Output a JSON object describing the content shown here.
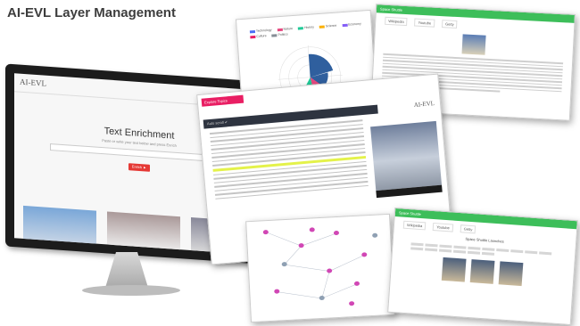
{
  "page": {
    "title": "AI-EVL Layer Management"
  },
  "monitor": {
    "logo": "AI-EVL",
    "heading": "Text Enrichment",
    "subheading": "Paste or write your text below and press Enrich",
    "button": "Enrich ►"
  },
  "topics_panel": {
    "tab": "Explore Topics",
    "bar_label": "Auto scroll  ✔",
    "logo": "AI-EVL"
  },
  "rose_panel": {
    "legend": [
      {
        "label": "Technology",
        "color": "#4c6ef5"
      },
      {
        "label": "Nature",
        "color": "#e64980"
      },
      {
        "label": "History",
        "color": "#20c997"
      },
      {
        "label": "Science",
        "color": "#fab005"
      },
      {
        "label": "Economy",
        "color": "#845ef7"
      },
      {
        "label": "Culture",
        "color": "#e91e63"
      },
      {
        "label": "Politics",
        "color": "#868e96"
      }
    ]
  },
  "recommender_top": {
    "header": "Space Shuttle",
    "tabs": [
      "Wikipedia",
      "Youtube",
      "Getty"
    ]
  },
  "recommender_bottom": {
    "header": "Space Shuttle",
    "tabs": [
      "Wikipedia",
      "Youtube",
      "Getty"
    ],
    "subtitle": "Space Shuttle Launches"
  }
}
